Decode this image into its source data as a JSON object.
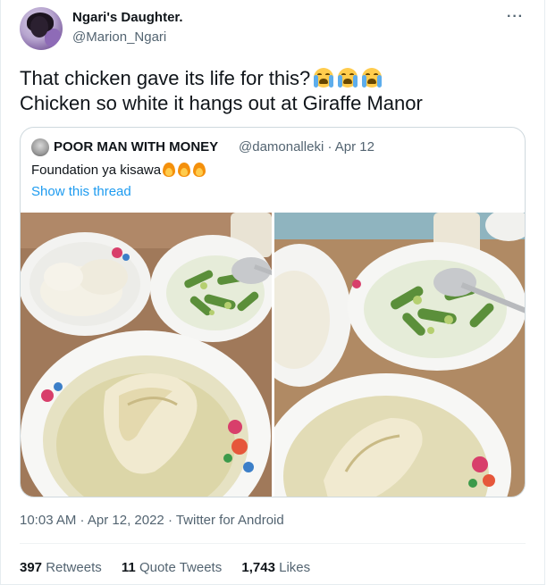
{
  "author": {
    "display_name": "Ngari's Daughter.",
    "handle": "@Marion_Ngari"
  },
  "menu": {
    "more_label": "···"
  },
  "tweet": {
    "line1": "That chicken gave its life for this?",
    "line1_emoji": [
      "loudly-crying-face",
      "loudly-crying-face",
      "loudly-crying-face"
    ],
    "line2": "Chicken so white it hangs out at Giraffe Manor"
  },
  "quoted": {
    "display_name": "POOR MAN WITH MONEY",
    "handle_date": "@damonalleki · Apr 12",
    "text": "Foundation ya kisawa",
    "text_emoji": [
      "fire",
      "fire",
      "fire"
    ],
    "show_thread": "Show this thread",
    "photos": [
      "food-photo-chicken-soup-ugali-okra",
      "food-photo-chicken-soup-ugali-okra-alt"
    ]
  },
  "meta": {
    "timestamp": "10:03 AM · Apr 12, 2022 · Twitter for Android"
  },
  "stats": {
    "retweets_count": "397",
    "retweets_label": "Retweets",
    "quotes_count": "11",
    "quotes_label": "Quote Tweets",
    "likes_count": "1,743",
    "likes_label": "Likes"
  },
  "colors": {
    "link": "#1d9bf0",
    "secondary_text": "#536471",
    "primary_text": "#0f1419",
    "border": "#cfd9de"
  }
}
